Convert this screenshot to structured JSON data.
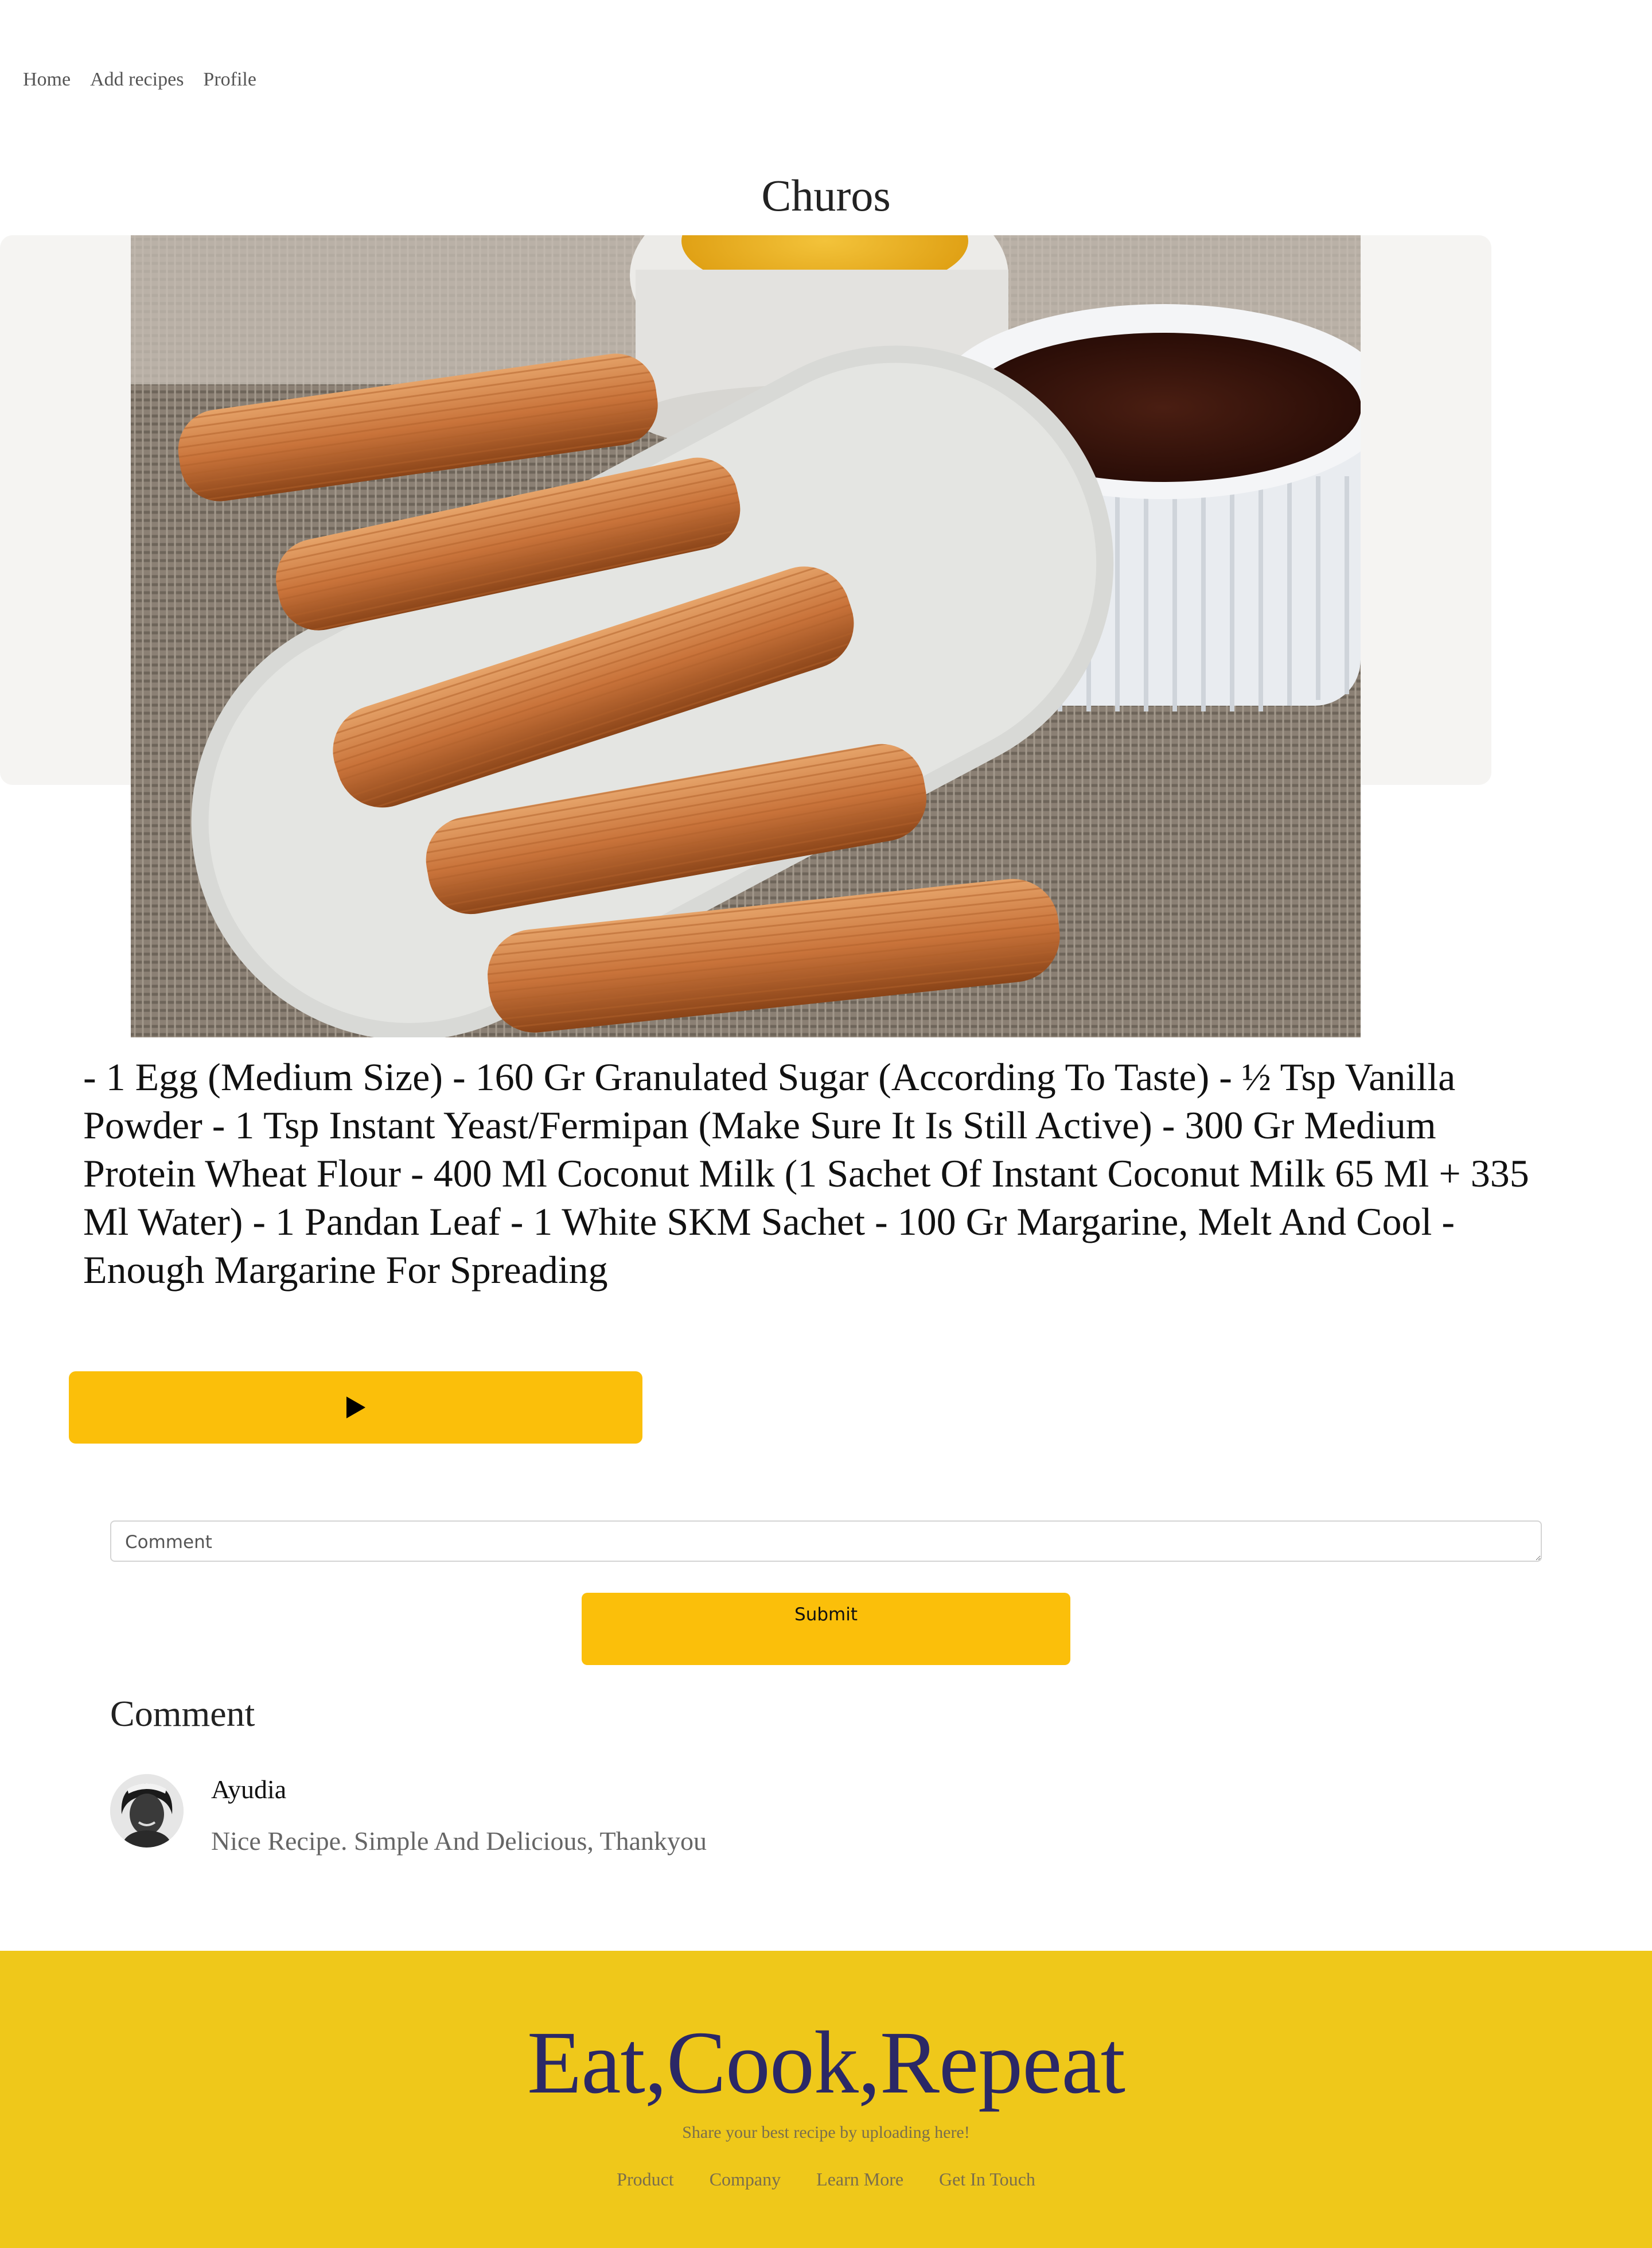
{
  "nav": {
    "items": [
      "Home",
      "Add recipes",
      "Profile"
    ]
  },
  "recipe": {
    "title": "Churos",
    "ingredients": "- 1 Egg (Medium Size) - 160 Gr Granulated Sugar (According To Taste) - ½ Tsp Vanilla Powder - 1 Tsp Instant Yeast/Fermipan (Make Sure It Is Still Active) - 300 Gr Medium Protein Wheat Flour - 400 Ml Coconut Milk (1 Sachet Of Instant Coconut Milk 65 Ml + 335 Ml Water) - 1 Pandan Leaf - 1 White SKM Sachet - 100 Gr Margarine, Melt And Cool - Enough Margarine For Spreading",
    "image_icon": "churros-photo",
    "play_icon": "play-icon"
  },
  "comment_form": {
    "placeholder": "Comment",
    "submit_label": "Submit"
  },
  "comments": {
    "heading": "Comment",
    "items": [
      {
        "name": "Ayudia",
        "text": "Nice Recipe. Simple And Delicious, Thankyou",
        "avatar_icon": "user-avatar"
      }
    ]
  },
  "footer": {
    "brand": "Eat,Cook,Repeat",
    "tagline": "Share your best recipe by uploading here!",
    "links": [
      "Product",
      "Company",
      "Learn More",
      "Get In Touch"
    ]
  },
  "colors": {
    "accent": "#fbbf0a",
    "footer_bg": "#efc81a",
    "brand_text": "#2b2866",
    "hero_bg": "#f5f4f2"
  }
}
